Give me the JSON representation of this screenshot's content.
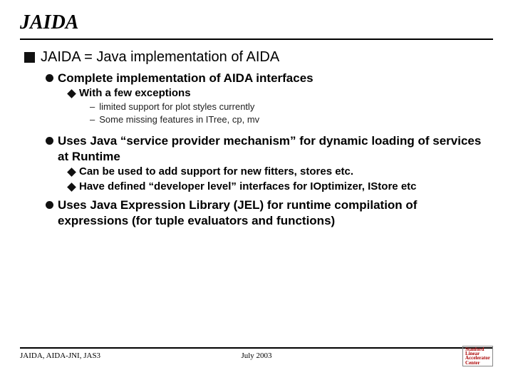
{
  "title": "JAIDA",
  "content": {
    "b1": "JAIDA = Java implementation of AIDA",
    "b1a": "Complete implementation of AIDA interfaces",
    "b1a1": "With a few exceptions",
    "b1a1x": "limited support for plot styles currently",
    "b1a1y": "Some missing features in ITree, cp, mv",
    "b1b": "Uses Java “service provider mechanism” for dynamic loading of services at Runtime",
    "b1b1": "Can be used to add support for new fitters, stores etc.",
    "b1b2": "Have defined “developer level” interfaces for IOptimizer, IStore etc",
    "b1c": "Uses Java Expression Library (JEL) for runtime compilation of expressions (for tuple evaluators and functions)"
  },
  "dash": "–",
  "footer": {
    "left": "JAIDA, AIDA-JNI, JAS3",
    "center": "July 2003",
    "logo": {
      "l1": "Stanford",
      "l2": "Linear",
      "l3": "Accelerator",
      "l4": "Center"
    }
  }
}
